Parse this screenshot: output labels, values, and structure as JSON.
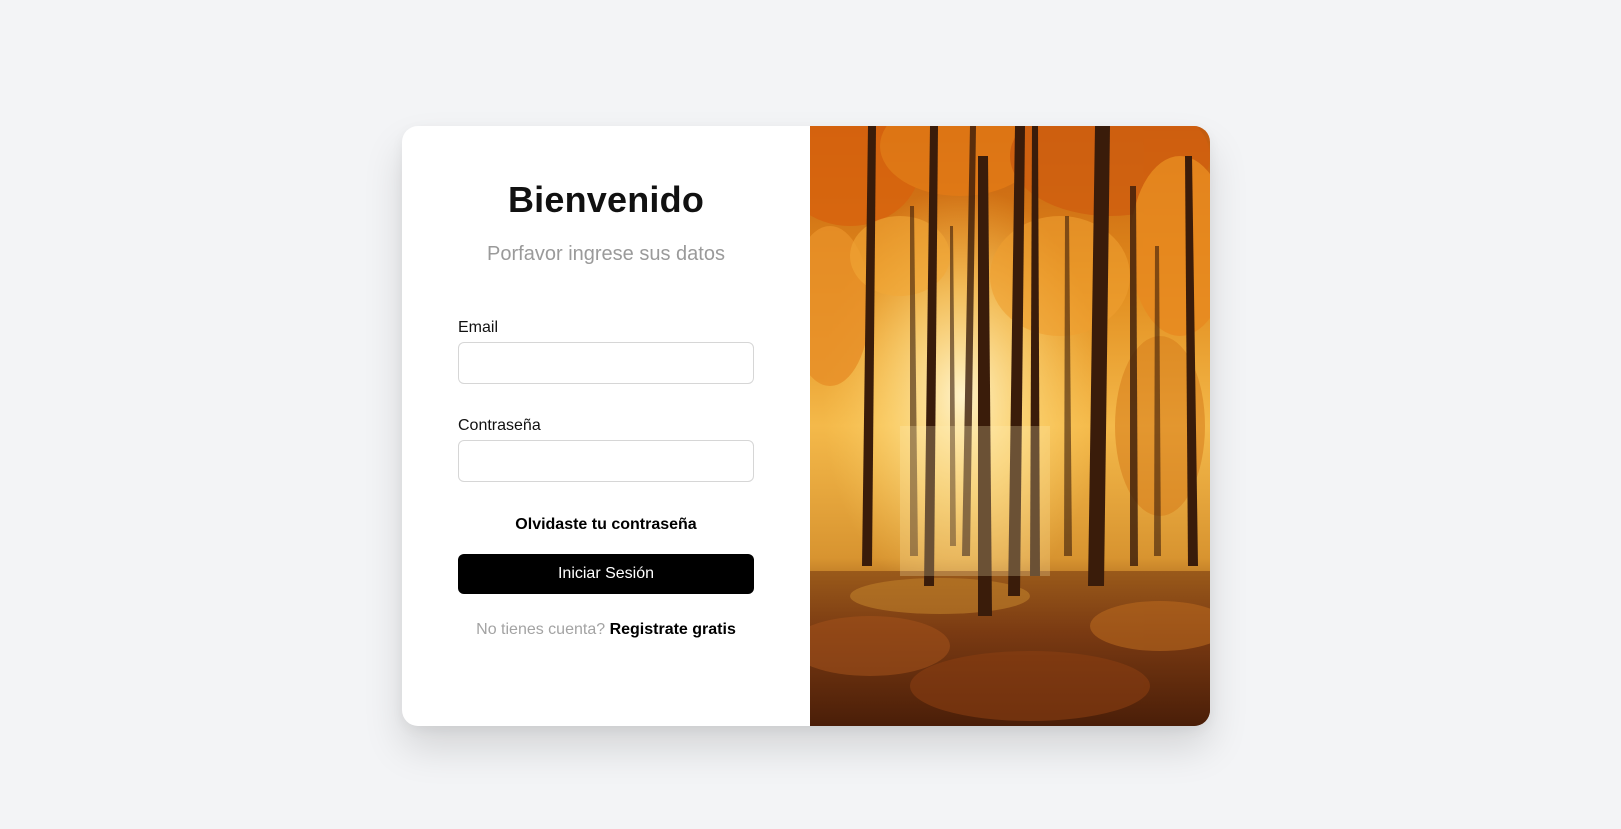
{
  "login": {
    "title": "Bienvenido",
    "subtitle": "Porfavor ingrese sus datos",
    "email_label": "Email",
    "email_value": "",
    "password_label": "Contraseña",
    "password_value": "",
    "forgot_label": "Olvidaste tu contraseña",
    "submit_label": "Iniciar Sesión",
    "signup_prompt": "No tienes cuenta?",
    "signup_link": "Registrate gratis"
  },
  "image": {
    "subject": "autumn forest photo"
  },
  "colors": {
    "background": "#f3f4f6",
    "card": "#ffffff",
    "primary_button": "#000000",
    "muted_text": "#9a9a9a"
  }
}
